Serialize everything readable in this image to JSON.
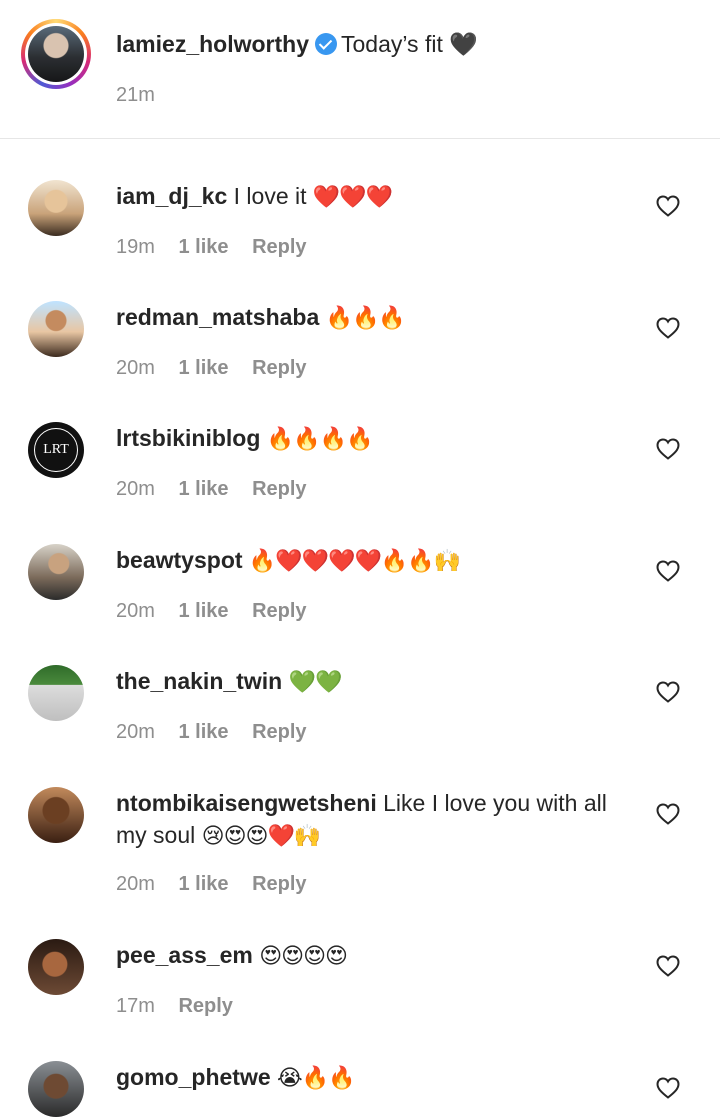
{
  "post": {
    "username": "lamiez_holworthy",
    "caption": "Today’s fit 🖤",
    "time": "21m"
  },
  "comments": [
    {
      "username": "iam_dj_kc",
      "text": "I love it",
      "emoji": "❤️❤️❤️",
      "time": "19m",
      "likes": "1 like",
      "reply": "Reply"
    },
    {
      "username": "redman_matshaba",
      "text": "",
      "emoji": "🔥🔥🔥",
      "time": "20m",
      "likes": "1 like",
      "reply": "Reply"
    },
    {
      "username": "lrtsbikiniblog",
      "text": "",
      "emoji": "🔥🔥🔥🔥",
      "time": "20m",
      "likes": "1 like",
      "reply": "Reply"
    },
    {
      "username": "beawtyspot",
      "text": "",
      "emoji": "🔥❤️❤️❤️❤️🔥🔥🙌",
      "time": "20m",
      "likes": "1 like",
      "reply": "Reply"
    },
    {
      "username": "the_nakin_twin",
      "text": "",
      "emoji": "💚💚",
      "time": "20m",
      "likes": "1 like",
      "reply": "Reply"
    },
    {
      "username": "ntombikaisengwetsheni",
      "text": "Like I love you with all my soul",
      "emoji": "😢😍😍❤️🙌",
      "time": "20m",
      "likes": "1 like",
      "reply": "Reply"
    },
    {
      "username": "pee_ass_em",
      "text": "",
      "emoji": "😍😍😍😍",
      "time": "17m",
      "likes": "",
      "reply": "Reply"
    },
    {
      "username": "gomo_phetwe",
      "text": "",
      "emoji": "😭🔥🔥",
      "time": "",
      "likes": "",
      "reply": ""
    }
  ],
  "avatar_labels": {
    "lrt": "LRT"
  },
  "icons": {
    "verified": "verified-badge-icon",
    "heart": "heart-outline-icon"
  },
  "colors": {
    "verified": "#3897f0",
    "secondary_text": "#8e8e8e",
    "primary_text": "#262626"
  }
}
